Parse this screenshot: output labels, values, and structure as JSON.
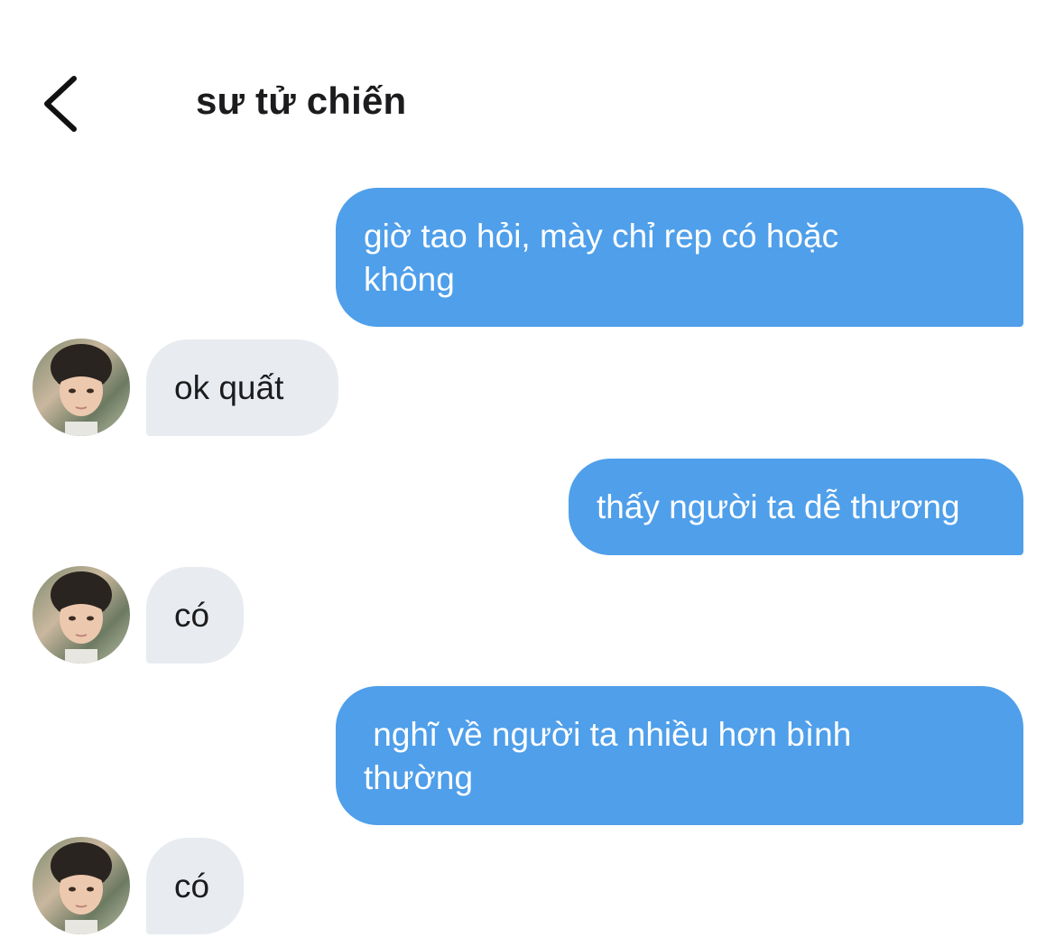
{
  "header": {
    "back_icon": "chevron-left-icon",
    "title": "sư tử chiến"
  },
  "messages": [
    {
      "direction": "outgoing",
      "text": "giờ tao hỏi, mày chỉ rep có hoặc\nkhông"
    },
    {
      "direction": "incoming",
      "text": "ok quất"
    },
    {
      "direction": "outgoing",
      "text": "thấy người ta dễ thương"
    },
    {
      "direction": "incoming",
      "text": "có"
    },
    {
      "direction": "outgoing",
      "text": " nghĩ về người ta nhiều hơn bình\nthường"
    },
    {
      "direction": "incoming",
      "text": "có"
    }
  ],
  "colors": {
    "outgoing_bubble": "#4f9fea",
    "incoming_bubble": "#e8ecf0",
    "title_text": "#1c1c1e"
  }
}
